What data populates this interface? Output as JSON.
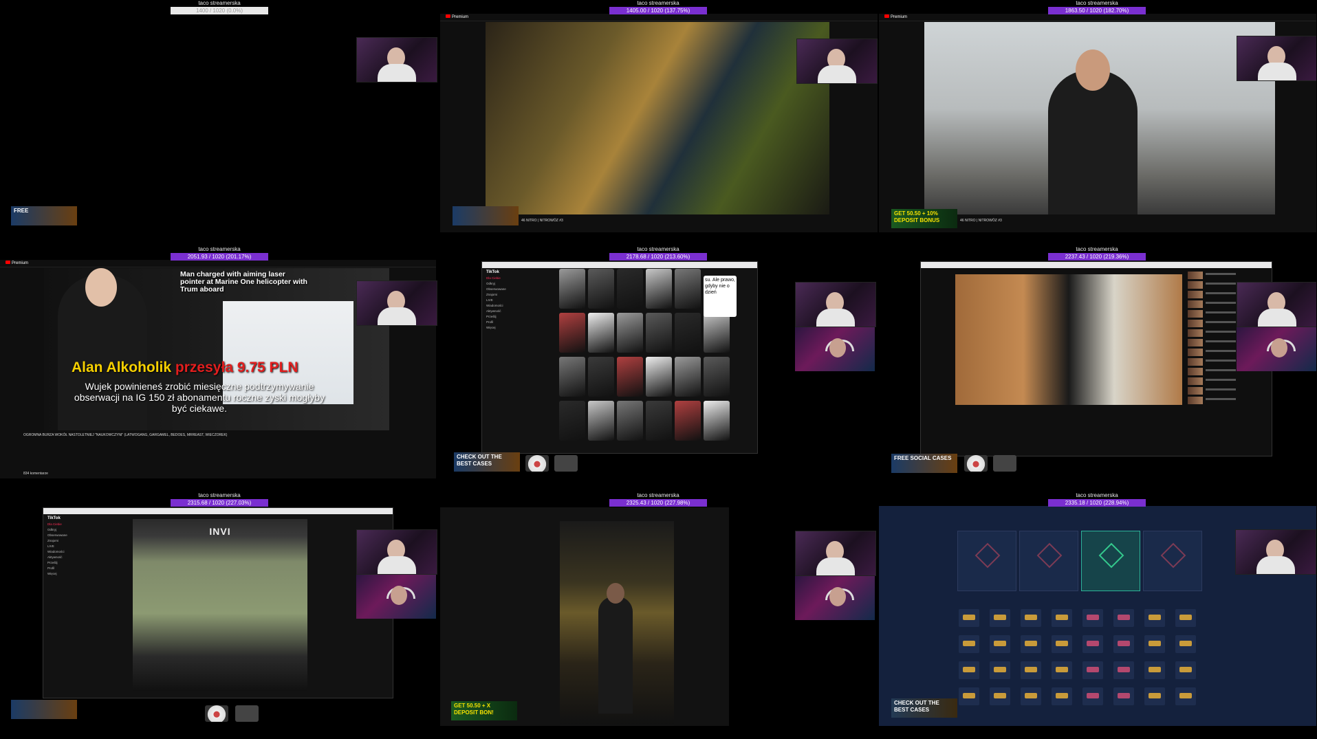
{
  "overlay_name": "taco streamerska",
  "tiles": [
    {
      "id": "t1",
      "stat": "1400 / 1020 (0.0%)"
    },
    {
      "id": "t2",
      "stat": "1405.00 / 1020 (137.75%)"
    },
    {
      "id": "t3",
      "stat": "1863.50 / 1020 (182.70%)"
    },
    {
      "id": "t4",
      "stat": "2051.93 / 1020 (201.17%)"
    },
    {
      "id": "t5",
      "stat": "2178.68 / 1020 (213.60%)"
    },
    {
      "id": "t6",
      "stat": "2237.43 / 1020 (219.36%)"
    },
    {
      "id": "t7",
      "stat": "2315.68 / 1020 (227.03%)"
    },
    {
      "id": "t8",
      "stat": "2325.43 / 1020 (227.98%)"
    },
    {
      "id": "t9",
      "stat": "2335.18 / 1020 (228.94%)"
    }
  ],
  "ads": {
    "free": "FREE",
    "check_out": "CHECK OUT THE BEST CASES",
    "deposit": "GET 50.50 + 10% DEPOSIT BONUS",
    "free_social": "FREE SOCIAL CASES",
    "deposit_short": "GET 50.50 + X DEPOSIT BON!"
  },
  "youtube": {
    "logo": "Premium",
    "video_title_2": "46 NITRO | NITROWÓZ #3",
    "video_title_4": "OGROMNA BURZA WOKÓŁ NASTOLETNIEJ \"NAUKOWCZYNI\" (LATWOGANG, GARGAMEL, BEDOES, MRREAST, WIECZOREK)",
    "comments": "834 komentarze"
  },
  "donation": {
    "donor": "Alan Alkoholik",
    "action": "przesyła",
    "amount": "9.75 PLN",
    "message": "Wujek powinieneś zrobić miesięczne podtrzymywanie obserwacji na IG 150 zł abonamentu roczne zyski mogłyby być ciekawe."
  },
  "news_headline": "Man charged with aiming laser pointer at Marine One helicopter with Trum aboard",
  "tiktok": {
    "logo": "TikTok",
    "menu": [
      "Dla Ciebie",
      "Odkryj",
      "Obserwowane",
      "Znajomi",
      "LIVE",
      "Wiadomości",
      "Aktywność",
      "Prześlij",
      "Profil",
      "Więcej"
    ],
    "tile_text": "su. Ale prawo, gdyby nie o dzień",
    "sign": "INVI"
  },
  "colors": {
    "accent": "#7a2fd0",
    "yt_red": "#ff0000",
    "dash_bg": "#14213d",
    "tiktok_pink": "#fe2c55"
  }
}
